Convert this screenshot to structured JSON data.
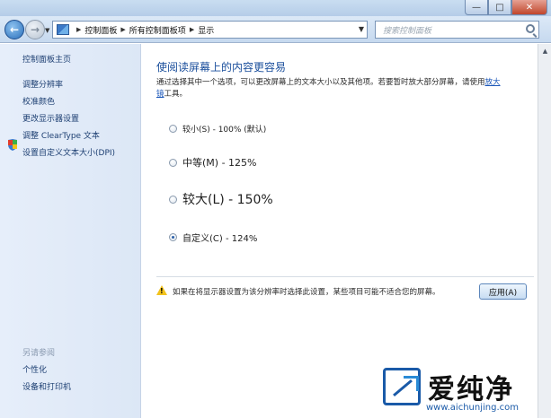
{
  "window": {
    "controls": {
      "minimize": "—",
      "maximize": "□",
      "close": "✕"
    }
  },
  "nav": {
    "back_icon": "←",
    "forward_icon": "→",
    "breadcrumbs": [
      "控制面板",
      "所有控制面板项",
      "显示"
    ],
    "refresh_icon": "↻",
    "search_placeholder": "搜索控制面板"
  },
  "sidebar": {
    "items": [
      {
        "label": "控制面板主页"
      },
      {
        "label": "调整分辨率"
      },
      {
        "label": "校准颜色"
      },
      {
        "label": "更改显示器设置"
      },
      {
        "label": "调整 ClearType 文本"
      },
      {
        "label": "设置自定义文本大小(DPI)"
      }
    ],
    "see_also_title": "另请参阅",
    "see_also": [
      {
        "label": "个性化"
      },
      {
        "label": "设备和打印机"
      }
    ]
  },
  "main": {
    "title": "使阅读屏幕上的内容更容易",
    "description_text": "通过选择其中一个选项，可以更改屏幕上的文本大小以及其他项。若要暂时放大部分屏幕，请使用",
    "description_link_1": "放大",
    "description_link_2": "镜",
    "description_suffix": "工具。",
    "options": [
      {
        "label": "较小(S) - 100% (默认)",
        "checked": false
      },
      {
        "label": "中等(M) - 125%",
        "checked": false
      },
      {
        "label": "较大(L) - 150%",
        "checked": false
      },
      {
        "label": "自定义(C) - 124%",
        "checked": true
      }
    ],
    "warning": "如果在将显示器设置为该分辨率时选择此设置，某些项目可能不适合您的屏幕。",
    "apply_label": "应用(A)"
  },
  "watermark": {
    "cn": "爱纯净",
    "en": "www.aichunjing.com"
  }
}
